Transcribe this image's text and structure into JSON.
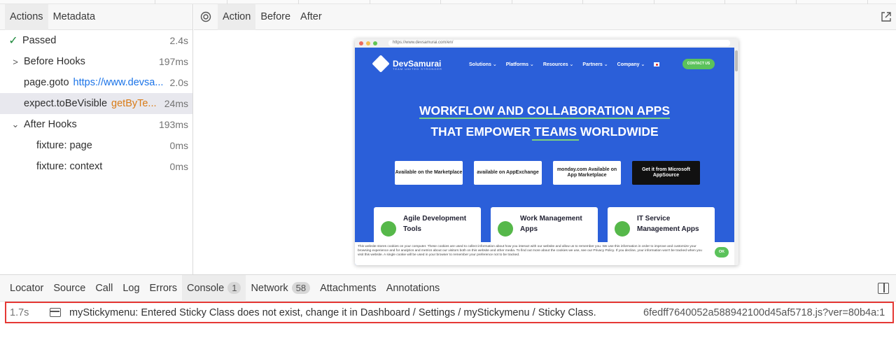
{
  "left_tabs": [
    "Actions",
    "Metadata"
  ],
  "status": {
    "label": "Passed",
    "duration": "2.4s"
  },
  "actions": [
    {
      "label": "Before Hooks",
      "duration": "197ms",
      "chevron": "right"
    },
    {
      "label": "page.goto",
      "param": "https://www.devsa...",
      "duration": "2.0s"
    },
    {
      "label": "expect.toBeVisible",
      "param": "getByTe...",
      "duration": "24ms"
    },
    {
      "label": "After Hooks",
      "duration": "193ms",
      "chevron": "down"
    },
    {
      "label": "fixture: page",
      "duration": "0ms"
    },
    {
      "label": "fixture: context",
      "duration": "0ms"
    }
  ],
  "viewer_tabs": [
    "Action",
    "Before",
    "After"
  ],
  "screenshot": {
    "url": "https://www.devsamurai.com/en/",
    "logo": "DevSamurai",
    "logo_tagline": "TEAM UNITED STRONGER",
    "nav": [
      "Solutions ⌄",
      "Platforms ⌄",
      "Resources ⌄",
      "Partners ⌄",
      "Company ⌄"
    ],
    "contact": "CONTACT US",
    "hero_line1": "WORKFLOW AND COLLABORATION APPS",
    "hero_line2": "THAT EMPOWER TEAMS WORLDWIDE",
    "badges": [
      "Available on the Marketplace",
      "available on AppExchange",
      "monday.com Available on App Marketplace",
      "Get it from Microsoft AppSource"
    ],
    "cards": [
      "Agile Development Tools",
      "Work Management Apps",
      "IT Service Management Apps"
    ],
    "cookie_text": "This website stores cookies on your computer. These cookies are used to collect information about how you interact with our website and allow us to remember you. We use this information in order to improve and customize your browsing experience and for analytics and metrics about our visitors both on this website and other media. To find out more about the cookies we use, see our Privacy Policy. If you decline, your information won't be tracked when you visit this website. A single cookie will be used in your browser to remember your preference not to be tracked.",
    "cookie_ok": "OK"
  },
  "bottom_tabs": [
    {
      "label": "Locator"
    },
    {
      "label": "Source"
    },
    {
      "label": "Call"
    },
    {
      "label": "Log"
    },
    {
      "label": "Errors"
    },
    {
      "label": "Console",
      "count": "1"
    },
    {
      "label": "Network",
      "count": "58"
    },
    {
      "label": "Attachments"
    },
    {
      "label": "Annotations"
    }
  ],
  "console": {
    "time": "1.7s",
    "message": "myStickymenu: Entered Sticky Class does not exist, change it in Dashboard / Settings / myStickymenu / Sticky Class.",
    "source": "6fedff7640052a588942100d45af5718.js?ver=80b4a:1"
  },
  "colors": {
    "link": "#1a73e8",
    "locator": "#d97b16",
    "passed": "#1e8a3c",
    "highlight": "#e53935",
    "site_bg": "#2b5fd9"
  }
}
